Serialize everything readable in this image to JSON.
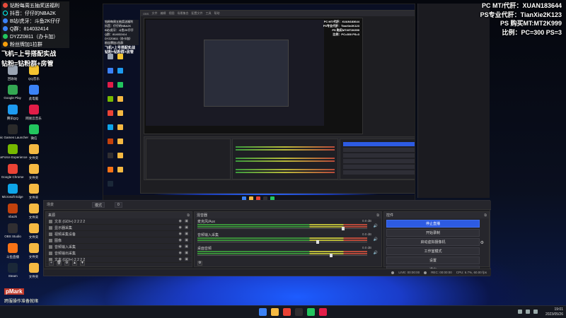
{
  "overlay_left": {
    "lines": [
      {
        "text": "钻粉每周五抽奖送福利",
        "color": "#e74c3c"
      },
      {
        "text": "抖音：仔仔的NBA2K",
        "color": "#111111"
      },
      {
        "text": "B站/虎牙：斗鱼2K仔仔",
        "color": "#3b82f6"
      },
      {
        "text": "Q群：814032414",
        "color": "#3b82f6"
      },
      {
        "text": "DYZZ0811（办卡加）",
        "color": "#22c55e"
      },
      {
        "text": "粉丝牌加1拉群",
        "color": "#f59e0b"
      }
    ],
    "big_lines": [
      "飞机=上号搭配实战",
      "钻粉=钻粉群+房管"
    ]
  },
  "overlay_right": {
    "lines": [
      "PC MT/代肝：XUAN183644",
      "PS专业代肝：TianXie2K123",
      "PS 购买MT:MT2K999",
      "比例：PC=300 PS=3"
    ]
  },
  "overlay_bottom_left": {
    "logo": "pMark",
    "text": "跨服操作准备就绪"
  },
  "inner_overlay": {
    "lines": [
      "钻粉每周五抽奖送福利",
      "抖音：仔仔的NBA2K",
      "B站/虎牙：斗鱼2K仔仔",
      "Q群：814032414",
      "DYZZ0811（办卡加）",
      "粉丝牌加1拉群"
    ],
    "big_lines": [
      "飞机=上号搭配实战",
      "钻粉=钻粉群+房管"
    ]
  },
  "inner_overlay_right": {
    "lines": [
      "PC MT/代肝：XUAN183644",
      "PS专业代肝：TianXie2K123",
      "PS 购买MT:MT2K999",
      "比例：PC=300 PS=3"
    ]
  },
  "desktop_icons": [
    {
      "label": "回收站",
      "color": "#9aa4b2"
    },
    {
      "label": "QQ音乐",
      "color": "#f4c430"
    },
    {
      "label": "Google Play",
      "color": "#34a853"
    },
    {
      "label": "此电脑",
      "color": "#3b82f6"
    },
    {
      "label": "腾讯QQ",
      "color": "#1d9bf0"
    },
    {
      "label": "网易云音乐",
      "color": "#e11d48"
    },
    {
      "label": "Epic Games Launcher",
      "color": "#2a2a2a"
    },
    {
      "label": "微信",
      "color": "#22c55e"
    },
    {
      "label": "GeForce Experience",
      "color": "#76b900"
    },
    {
      "label": "文件夹",
      "color": "#f5b942"
    },
    {
      "label": "Google Chrome",
      "color": "#ea4335"
    },
    {
      "label": "文件夹",
      "color": "#f5b942"
    },
    {
      "label": "Microsoft Edge",
      "color": "#0ea5e9"
    },
    {
      "label": "文件夹",
      "color": "#f5b942"
    },
    {
      "label": "nba2k",
      "color": "#c2410c"
    },
    {
      "label": "文件夹",
      "color": "#f5b942"
    },
    {
      "label": "OBS Studio",
      "color": "#302e31"
    },
    {
      "label": "文件夹",
      "color": "#f5b942"
    },
    {
      "label": "斗鱼直播",
      "color": "#f97316"
    },
    {
      "label": "文件夹",
      "color": "#f5b942"
    },
    {
      "label": "Steam",
      "color": "#1b2838"
    },
    {
      "label": "文件夹",
      "color": "#f5b942"
    }
  ],
  "obs": {
    "top_label": "场景",
    "top_buttons": [
      "模式",
      "0"
    ],
    "docks": {
      "sources": {
        "title": "来源",
        "rows": [
          "文本 (GDI+) 2 2 2 2",
          "显示器采集",
          "视频采集设备",
          "图像",
          "音频输入采集",
          "音频输出采集",
          "文本 (GDI+) 2 2 2 2"
        ],
        "footer": [
          "+",
          "🗑",
          "⚙",
          "▲",
          "▼"
        ]
      },
      "mixer": {
        "title": "混音器",
        "channels": [
          {
            "name": "麦克风/Aux",
            "db": "0.0 dB",
            "level": 0.85
          },
          {
            "name": "音频输入采集",
            "db": "0.0 dB",
            "level": 0.7
          },
          {
            "name": "桌面音频",
            "db": "0.0 dB",
            "level": 0.78
          }
        ]
      },
      "controls": {
        "title": "控件",
        "buttons": [
          "停止直播",
          "开始录制",
          "启动虚拟摄像机",
          "工作室模式",
          "设置",
          "退出"
        ],
        "active_index": 0
      }
    },
    "status": {
      "live": "LIVE: 00:00:00",
      "rec": "REC: 00:00:00",
      "cpu": "CPU: 6.7%, 60.00 fps"
    }
  },
  "taskbar": {
    "apps": [
      {
        "name": "windows-start",
        "color": "#3b82f6"
      },
      {
        "name": "file-explorer",
        "color": "#f5b942"
      },
      {
        "name": "chrome",
        "color": "#ea4335"
      },
      {
        "name": "obs",
        "color": "#302e31"
      },
      {
        "name": "wechat",
        "color": "#22c55e"
      },
      {
        "name": "app",
        "color": "#e11d48"
      }
    ],
    "clock_time": "19:01",
    "clock_date": "2023/05/26"
  }
}
